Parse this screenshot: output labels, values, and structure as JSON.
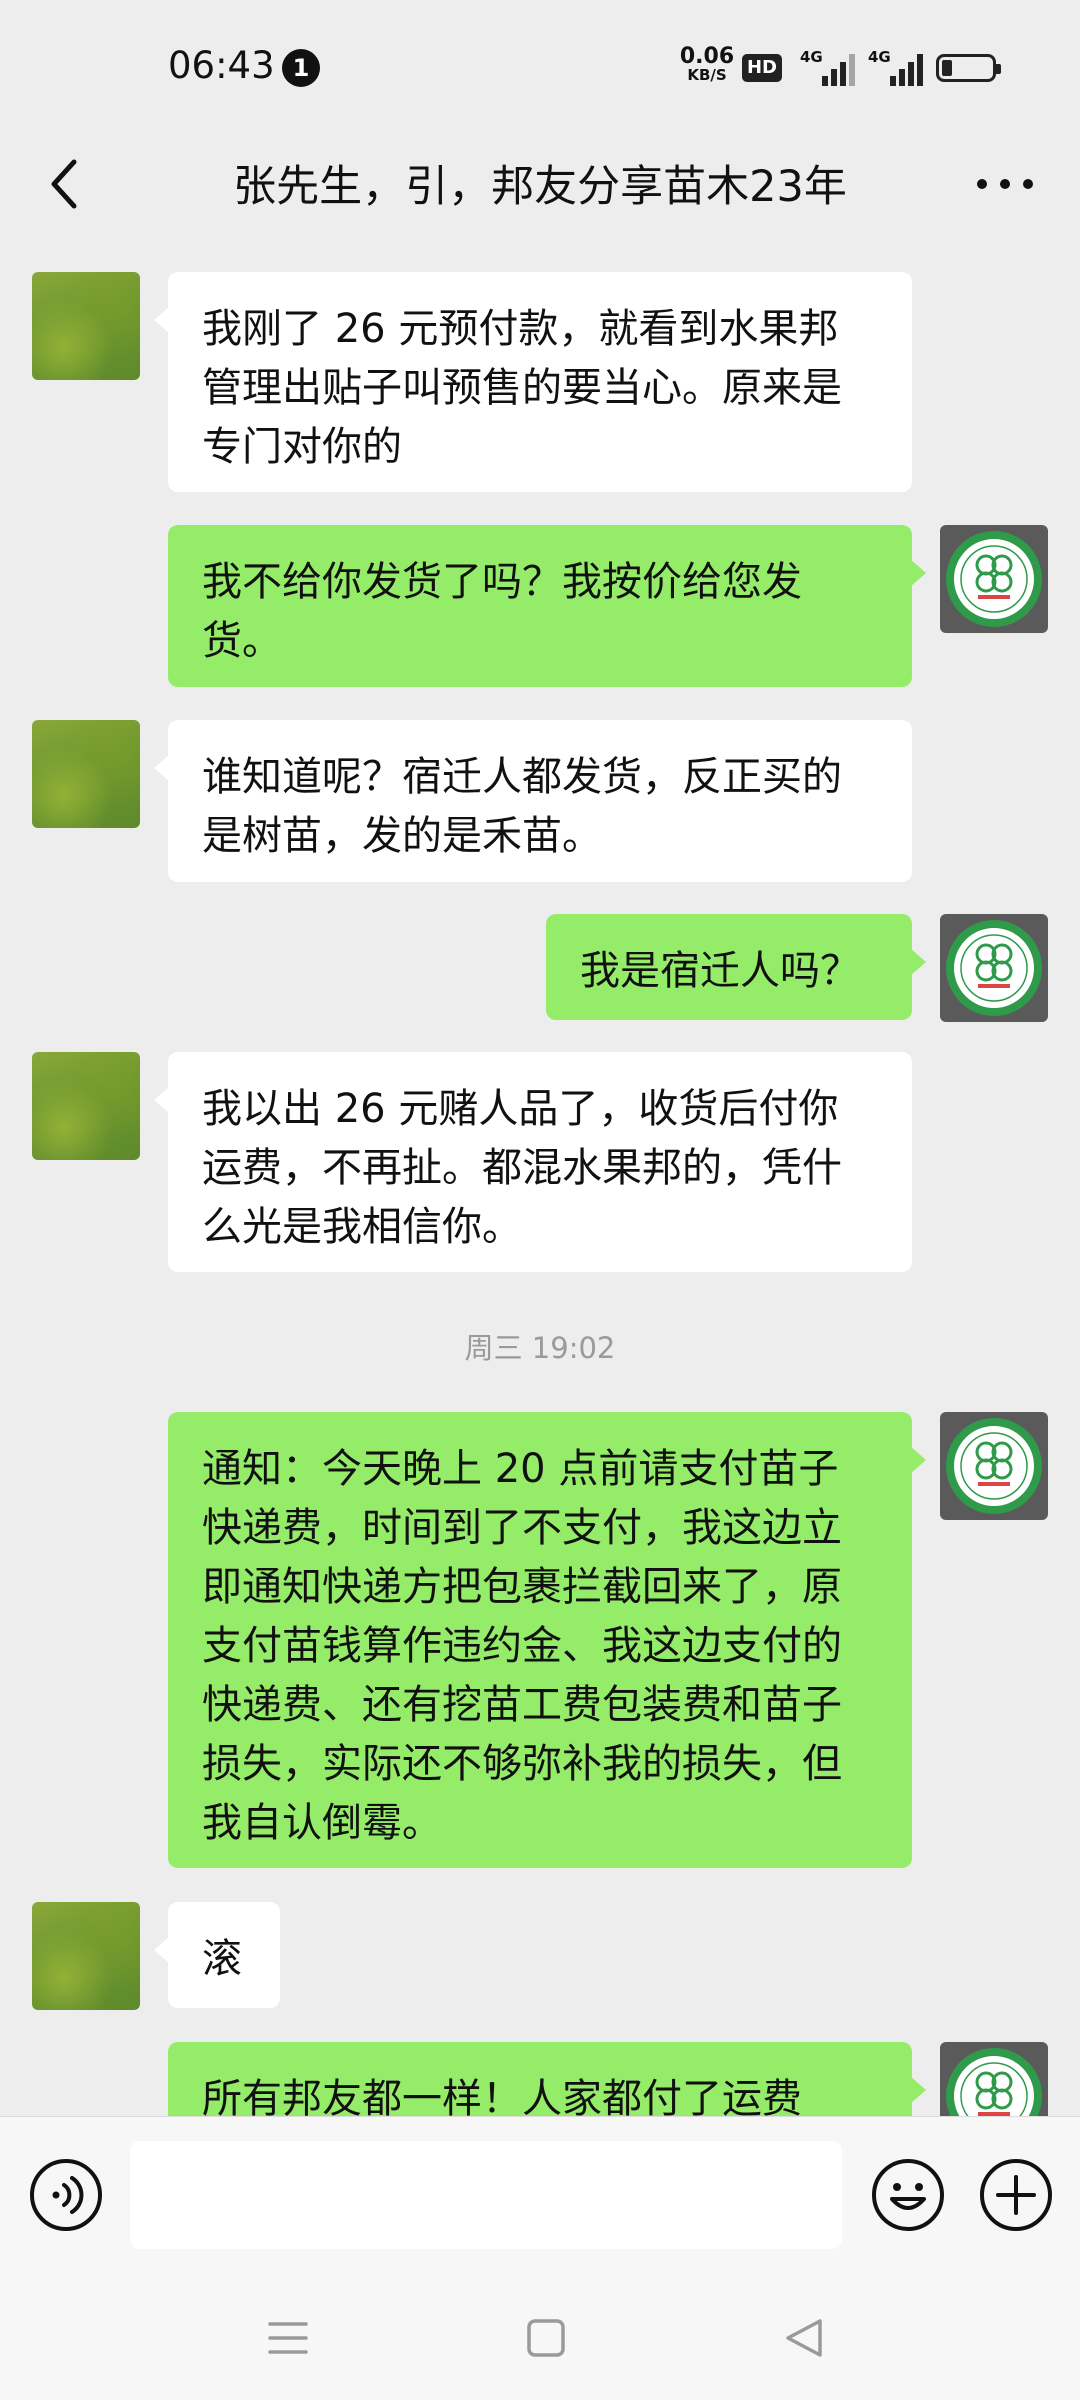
{
  "status_bar": {
    "time": "06:43",
    "notification_count": "1",
    "net_speed_value": "0.06",
    "net_speed_unit": "KB/S",
    "hd_label": "HD",
    "signal1_label": "4G",
    "signal2_label": "4G",
    "battery_level": 0.2
  },
  "header": {
    "title": "张先生，引，邦友分享苗木23年",
    "back_icon": "chevron-left-icon",
    "more_icon": "more-horizontal-icon"
  },
  "messages": [
    {
      "side": "in",
      "text": "我刚了 26 元预付款，就看到水果邦管理出贴子叫预售的要当心。原来是专门对你的"
    },
    {
      "side": "out",
      "text": "我不给你发货了吗？我按价给您发货。"
    },
    {
      "side": "in",
      "text": "谁知道呢？宿迁人都发货，反正买的是树苗，发的是禾苗。"
    },
    {
      "side": "out",
      "text": "我是宿迁人吗？"
    },
    {
      "side": "in",
      "text": "我以出 26 元赌人品了，收货后付你运费，不再扯。都混水果邦的，凭什么光是我相信你。"
    },
    {
      "side": "out",
      "text": "通知：今天晚上 20 点前请支付苗子快递费，时间到了不支付，我这边立即通知快递方把包裹拦截回来了，原支付苗钱算作违约金、我这边支付的快递费、还有挖苗工费包装费和苗子损失，实际还不够弥补我的损失，但我自认倒霉。"
    },
    {
      "side": "in",
      "text": "滚"
    },
    {
      "side": "out",
      "text": "所有邦友都一样！人家都付了运费"
    }
  ],
  "timestamp": "周三 19:02",
  "input": {
    "value": "",
    "voice_icon": "voice-icon",
    "emoji_icon": "emoji-icon",
    "plus_icon": "plus-icon"
  },
  "nav": {
    "menu_icon": "menu-icon",
    "home_icon": "home-icon",
    "back_icon": "back-triangle-icon"
  },
  "colors": {
    "background": "#ededed",
    "outgoing_bubble": "#95ec69",
    "incoming_bubble": "#ffffff",
    "logo_green": "#2e9a4a"
  }
}
